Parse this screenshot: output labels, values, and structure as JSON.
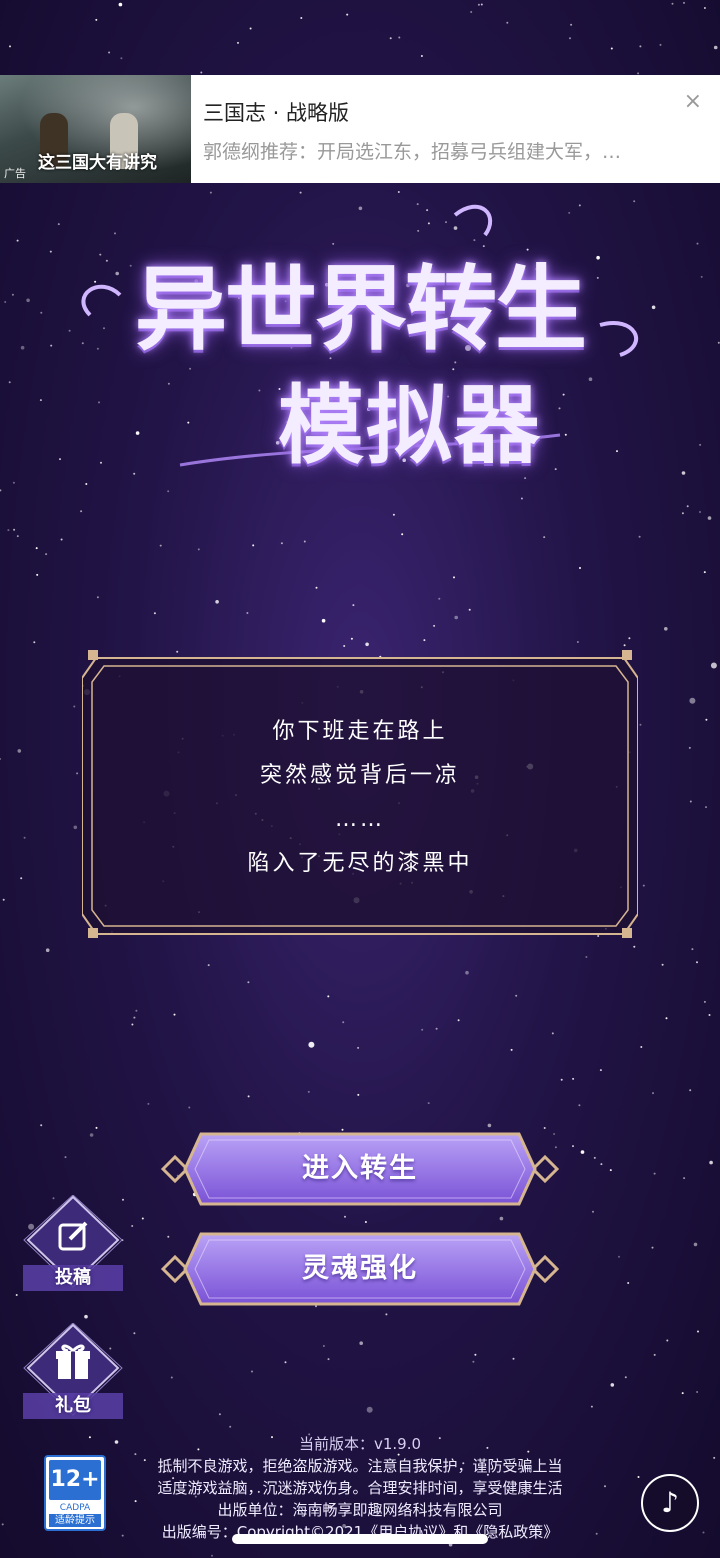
{
  "ad": {
    "image_title": "这三国大有讲究",
    "tag": "广告",
    "title": "三国志 · 战略版",
    "description": "郭德纲推荐：开局选江东，招募弓兵组建大军，…",
    "close_icon": "×"
  },
  "logo": {
    "line1": "异世界转生",
    "line2": "模拟器"
  },
  "story": {
    "lines": [
      "你下班走在路上",
      "突然感觉背后一凉",
      "……",
      "陷入了无尽的漆黑中"
    ]
  },
  "buttons": {
    "enter": "进入转生",
    "soul": "灵魂强化"
  },
  "side": {
    "submit": "投稿",
    "gift": "礼包"
  },
  "age_badge": {
    "rating": "12+",
    "org": "CADPA",
    "tip": "适龄提示"
  },
  "footer": {
    "version": "当前版本：v1.9.0",
    "line1": "抵制不良游戏，拒绝盗版游戏。注意自我保护，谨防受骗上当",
    "line2": "适度游戏益脑，沉迷游戏伤身。合理安排时间，享受健康生活",
    "line3": "出版单位：海南畅享即趣网络科技有限公司",
    "line4": "出版编号：Copyright©2021《用户协议》和《隐私政策》"
  },
  "colors": {
    "background": "#221447",
    "panel_border": "#d6b591",
    "button_fill": "#8b67e0",
    "age_blue": "#2a6fd1"
  },
  "icons": {
    "close": "close-icon",
    "edit": "edit-icon",
    "gift": "gift-icon",
    "music": "music-note-icon"
  }
}
